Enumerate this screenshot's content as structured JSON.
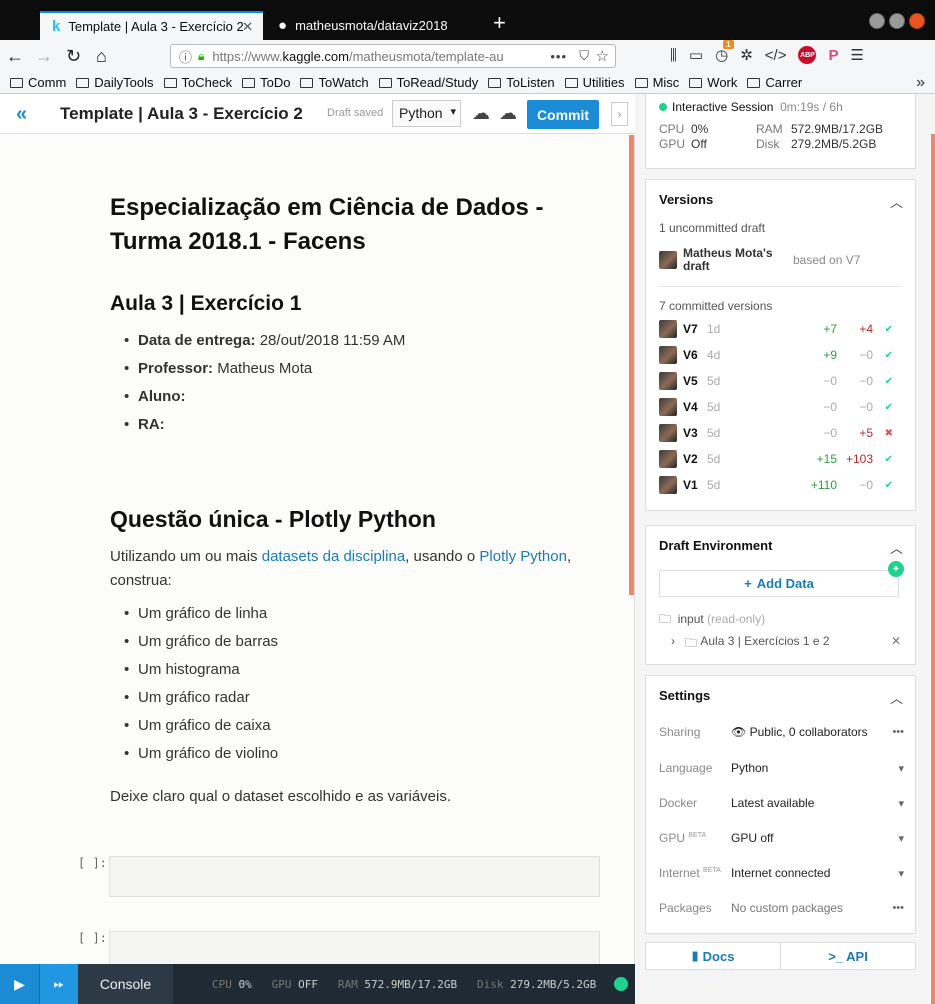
{
  "browser": {
    "tabs": [
      {
        "title": "Template | Aula 3 - Exercício 2",
        "icon": "k"
      },
      {
        "title": "matheusmota/dataviz2018",
        "icon": "github-icon"
      }
    ],
    "url_prefix": "https://www.",
    "url_host": "kaggle.com",
    "url_path": "/matheusmota/template-au",
    "bookmarks": [
      "Comm",
      "DailyTools",
      "ToCheck",
      "ToDo",
      "ToWatch",
      "ToRead/Study",
      "ToListen",
      "Utilities",
      "Misc",
      "Work",
      "Carrer"
    ],
    "addon_badge": "1",
    "abp_label": "ABP"
  },
  "header": {
    "title": "Template | Aula 3 - Exercício 2",
    "draft_status": "Draft saved",
    "language": "Python",
    "commit_label": "Commit"
  },
  "notebook": {
    "h1": "Especialização em Ciência de Dados - Turma 2018.1 - Facens",
    "h2_aula": "Aula 3 | Exercício 1",
    "info": [
      {
        "label": "Data de entrega:",
        "value": " 28/out/2018 11:59 AM"
      },
      {
        "label": "Professor:",
        "value": " Matheus Mota"
      },
      {
        "label": "Aluno:",
        "value": ""
      },
      {
        "label": "RA:",
        "value": ""
      }
    ],
    "h2_questao": "Questão única - Plotly Python",
    "intro_1": "Utilizando um ou mais ",
    "link_1": "datasets da disciplina",
    "intro_2": ", usando o ",
    "link_2": "Plotly Python",
    "intro_3": ", construa:",
    "tasks": [
      "Um gráfico de linha",
      "Um gráfico de barras",
      "Um histograma",
      "Um gráfico radar",
      "Um gráfico de caixa",
      "Um gráfico de violino"
    ],
    "closing": "Deixe claro qual o dataset escolhido e as variáveis.",
    "cell_prompt": "[ ]:"
  },
  "console": {
    "label": "Console",
    "cpu_k": "CPU",
    "cpu_v": "0%",
    "gpu_k": "GPU",
    "gpu_v": "OFF",
    "ram_k": "RAM",
    "ram_v": "572.9MB/17.2GB",
    "disk_k": "Disk",
    "disk_v": "279.2MB/5.2GB"
  },
  "session": {
    "label": "Interactive Session",
    "time": "0m:19s / 6h",
    "cpu_k": "CPU",
    "cpu_v": "0%",
    "gpu_k": "GPU",
    "gpu_v": "Off",
    "ram_k": "RAM",
    "ram_v": "572.9MB/17.2GB",
    "disk_k": "Disk",
    "disk_v": "279.2MB/5.2GB"
  },
  "versions": {
    "title": "Versions",
    "uncommitted": "1 uncommitted draft",
    "draft_name": "Matheus Mota's draft",
    "draft_based": "based on V7",
    "committed": "7 committed versions",
    "list": [
      {
        "name": "V7",
        "age": "1d",
        "add": "+7",
        "del": "+4",
        "status": "ok"
      },
      {
        "name": "V6",
        "age": "4d",
        "add": "+9",
        "del": "−0",
        "status": "ok"
      },
      {
        "name": "V5",
        "age": "5d",
        "add": "−0",
        "del": "−0",
        "status": "ok"
      },
      {
        "name": "V4",
        "age": "5d",
        "add": "−0",
        "del": "−0",
        "status": "ok"
      },
      {
        "name": "V3",
        "age": "5d",
        "add": "−0",
        "del": "+5",
        "status": "fail"
      },
      {
        "name": "V2",
        "age": "5d",
        "add": "+15",
        "del": "+103",
        "status": "ok"
      },
      {
        "name": "V1",
        "age": "5d",
        "add": "+110",
        "del": "−0",
        "status": "ok"
      }
    ]
  },
  "environment": {
    "title": "Draft Environment",
    "add_data": "Add Data",
    "input_label": "input",
    "input_note": "(read-only)",
    "dataset": "Aula 3 | Exercícios 1 e 2"
  },
  "settings": {
    "title": "Settings",
    "rows": [
      {
        "key": "Sharing",
        "beta": "",
        "value": "Public, 0 collaborators",
        "ctrl": "•••"
      },
      {
        "key": "Language",
        "beta": "",
        "value": "Python",
        "ctrl": "▾"
      },
      {
        "key": "Docker",
        "beta": "",
        "value": "Latest available",
        "ctrl": "▾"
      },
      {
        "key": "GPU",
        "beta": "BETA",
        "value": "GPU off",
        "ctrl": "▾"
      },
      {
        "key": "Internet",
        "beta": "BETA",
        "value": "Internet connected",
        "ctrl": "▾"
      },
      {
        "key": "Packages",
        "beta": "",
        "value": "No custom packages",
        "ctrl": "•••"
      }
    ]
  },
  "footer": {
    "docs": "Docs",
    "api": ">_ API"
  }
}
